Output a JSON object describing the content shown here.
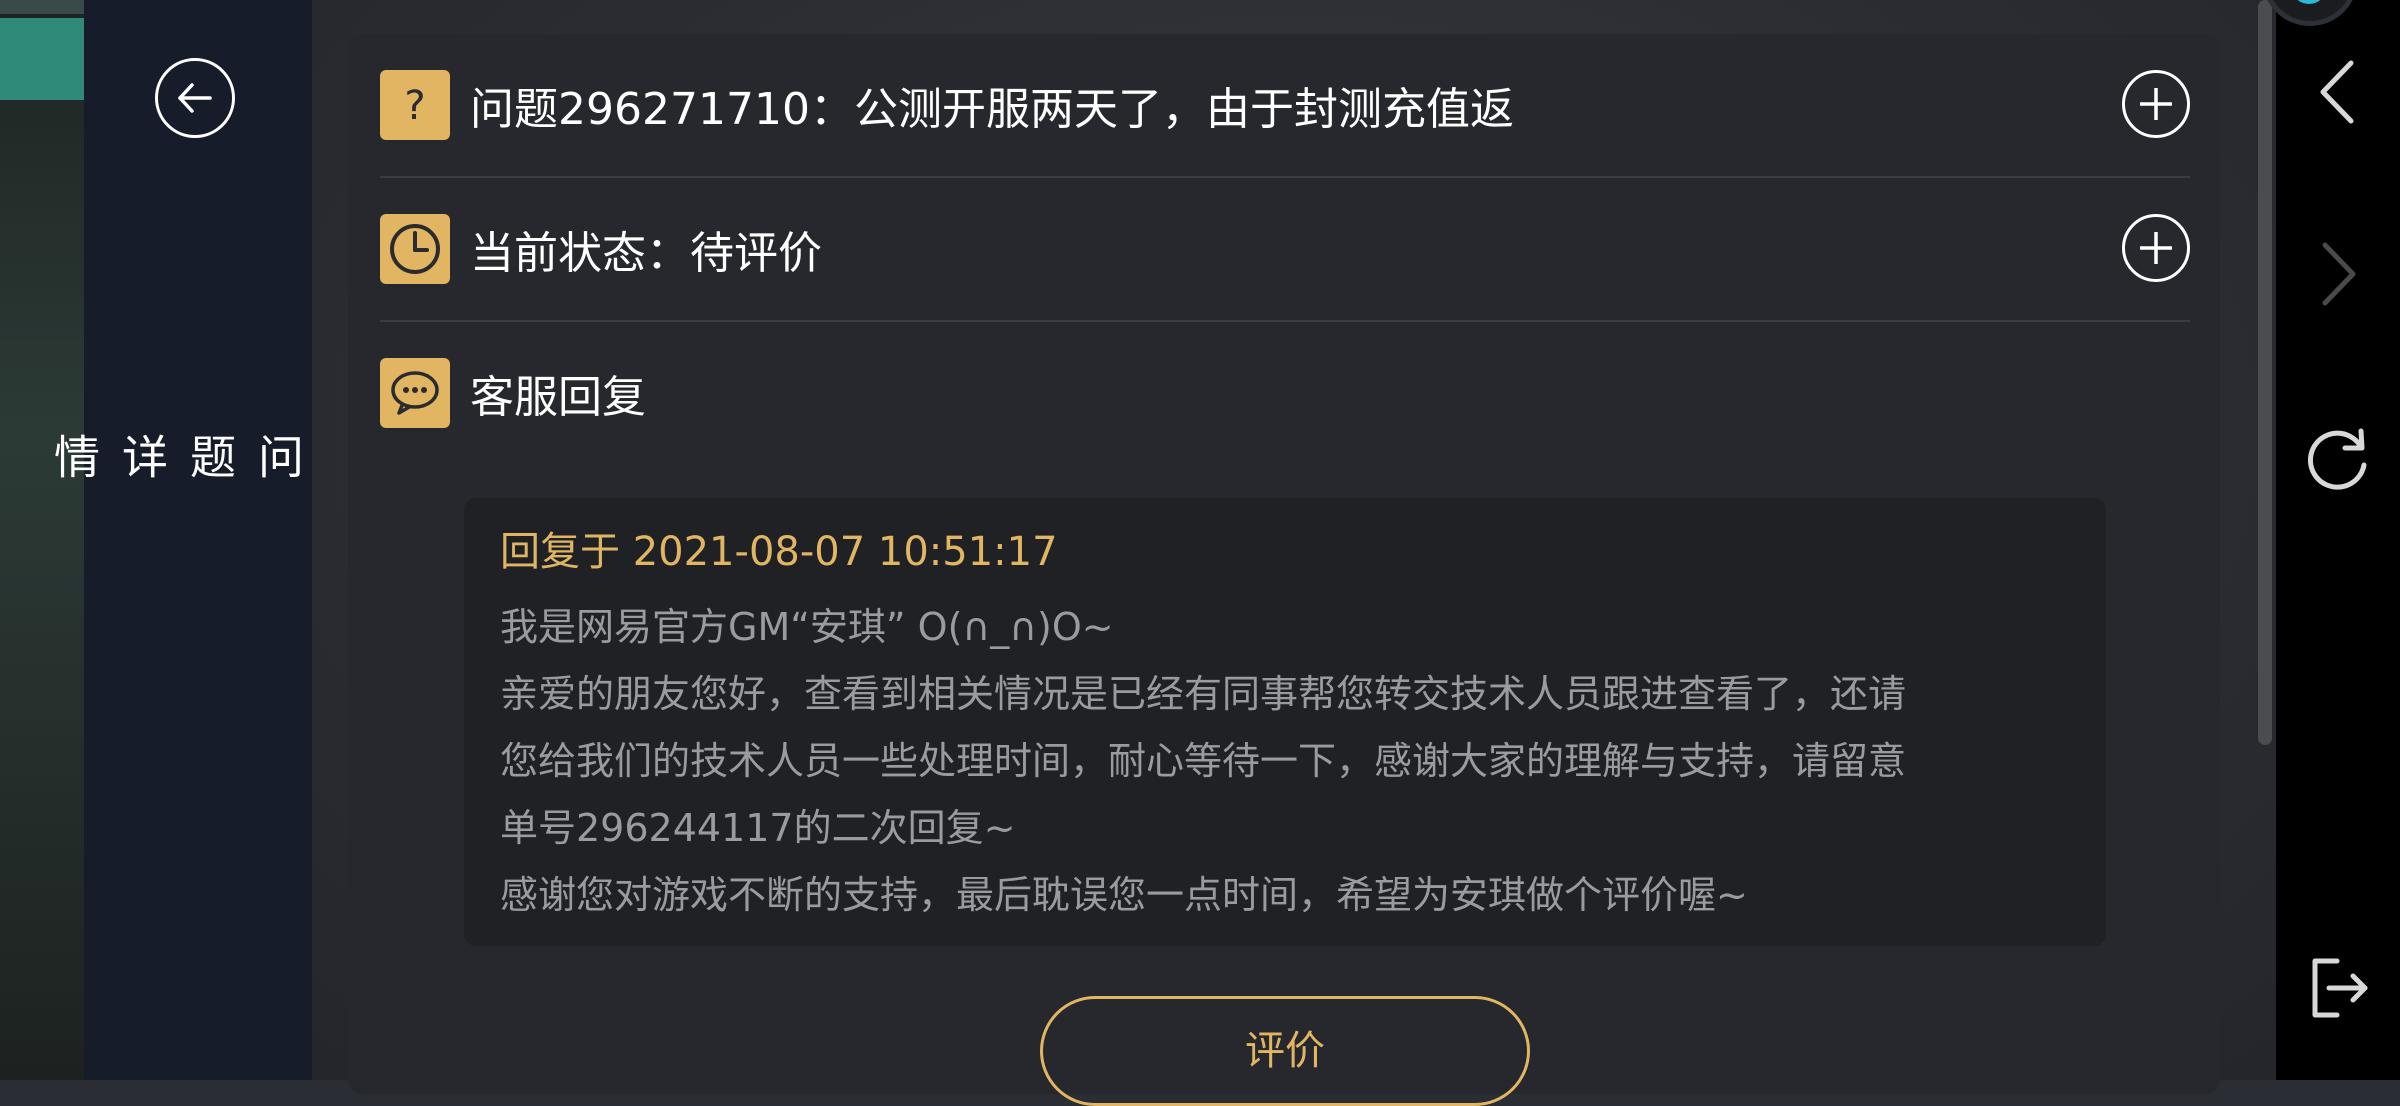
{
  "sidebar": {
    "back_icon": "arrow-left-icon",
    "title_chars": [
      "问",
      "题",
      "详",
      "情"
    ]
  },
  "question": {
    "icon": "question-icon",
    "text": "问题296271710：公测开服两天了，由于封测充值返"
  },
  "status": {
    "icon": "clock-icon",
    "text": "当前状态：待评价"
  },
  "support": {
    "icon": "chat-bubble-icon",
    "text": "客服回复"
  },
  "reply": {
    "time": "回复于 2021-08-07 10:51:17",
    "lines": [
      "我是网易官方GM“安琪” O(∩_∩)O~",
      "亲爱的朋友您好，查看到相关情况是已经有同事帮您转交技术人员跟进查看了，还请",
      "您给我们的技术人员一些处理时间，耐心等待一下，感谢大家的理解与支持，请留意",
      "单号296244117的二次回复~",
      "感谢您对游戏不断的支持，最后耽误您一点时间，希望为安琪做个评价喔~"
    ]
  },
  "actions": {
    "rate_label": "评价"
  },
  "colors": {
    "accent": "#e1b562",
    "panel": "#161c29",
    "card": "#26282d"
  },
  "nav_icons": [
    "chevron-left-icon",
    "chevron-right-icon",
    "refresh-icon",
    "exit-icon"
  ]
}
